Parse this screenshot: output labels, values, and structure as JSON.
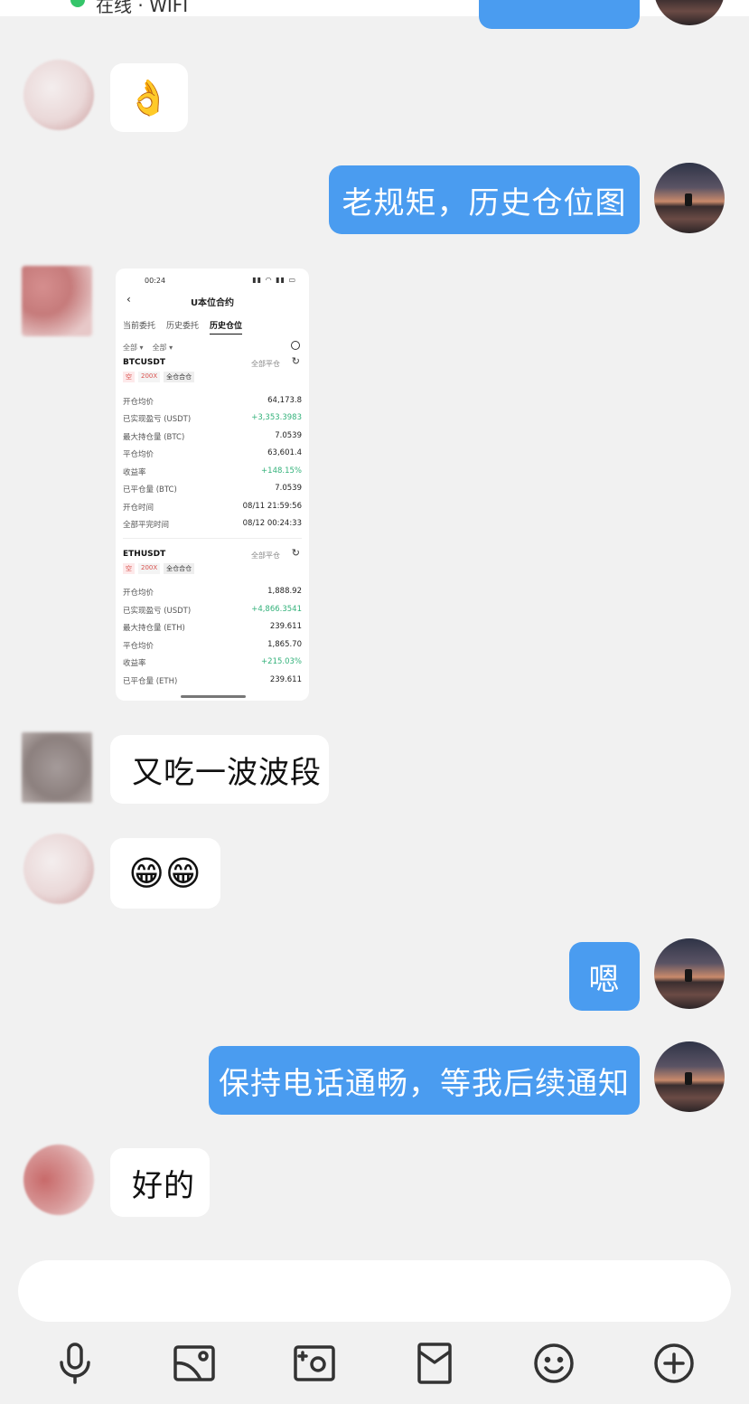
{
  "status": {
    "partial_text": "在线 · WIFI"
  },
  "messages": [
    {
      "side": "in",
      "type": "emoji",
      "text": "👌"
    },
    {
      "side": "out",
      "type": "text",
      "text": "老规矩，历史仓位图"
    },
    {
      "side": "in",
      "type": "image"
    },
    {
      "side": "in",
      "type": "text",
      "text": "又吃一波波段"
    },
    {
      "side": "in",
      "type": "emoji",
      "text": "😁😁"
    },
    {
      "side": "out",
      "type": "text",
      "text": "嗯"
    },
    {
      "side": "out",
      "type": "text",
      "text": "保持电话通畅，等我后续通知"
    },
    {
      "side": "in",
      "type": "text",
      "text": "好的"
    }
  ],
  "screenshot": {
    "time": "00:24",
    "status_icons": "▮▮ ◠ ▮▮ ▭",
    "title": "U本位合约",
    "tabs": [
      "当前委托",
      "历史委托",
      "历史仓位"
    ],
    "active_tab": "历史仓位",
    "filters": [
      "全部 ▾",
      "全部 ▾"
    ],
    "positions": [
      {
        "symbol": "BTCUSDT",
        "close_all": "全部平仓",
        "tags": [
          "空",
          "200X",
          "全仓合仓"
        ],
        "rows": [
          {
            "label": "开仓均价",
            "value": "64,173.8"
          },
          {
            "label": "已实现盈亏 (USDT)",
            "value": "+3,353.3983"
          },
          {
            "label": "最大持仓量 (BTC)",
            "value": "7.0539"
          },
          {
            "label": "平仓均价",
            "value": "63,601.4"
          },
          {
            "label": "收益率",
            "value": "+148.15%"
          },
          {
            "label": "已平仓量 (BTC)",
            "value": "7.0539"
          },
          {
            "label": "开仓时间",
            "value": "08/11 21:59:56"
          },
          {
            "label": "全部平完时间",
            "value": "08/12 00:24:33"
          }
        ]
      },
      {
        "symbol": "ETHUSDT",
        "close_all": "全部平仓",
        "tags": [
          "空",
          "200X",
          "全仓合仓"
        ],
        "rows": [
          {
            "label": "开仓均价",
            "value": "1,888.92"
          },
          {
            "label": "已实现盈亏 (USDT)",
            "value": "+4,866.3541"
          },
          {
            "label": "最大持仓量 (ETH)",
            "value": "239.611"
          },
          {
            "label": "平仓均价",
            "value": "1,865.70"
          },
          {
            "label": "收益率",
            "value": "+215.03%"
          },
          {
            "label": "已平仓量 (ETH)",
            "value": "239.611"
          }
        ]
      }
    ]
  },
  "input": {
    "placeholder": ""
  },
  "toolbar": {
    "voice": "mic-icon",
    "image": "image-icon",
    "camera": "camera-icon",
    "red_packet": "red-packet-icon",
    "emoji": "emoji-icon",
    "more": "plus-icon"
  },
  "colors": {
    "bubble_out": "#4a9cf0",
    "bubble_in": "#ffffff",
    "background": "#f1f1f1",
    "positive": "#34b27b",
    "short_tag": "#d9534f"
  }
}
